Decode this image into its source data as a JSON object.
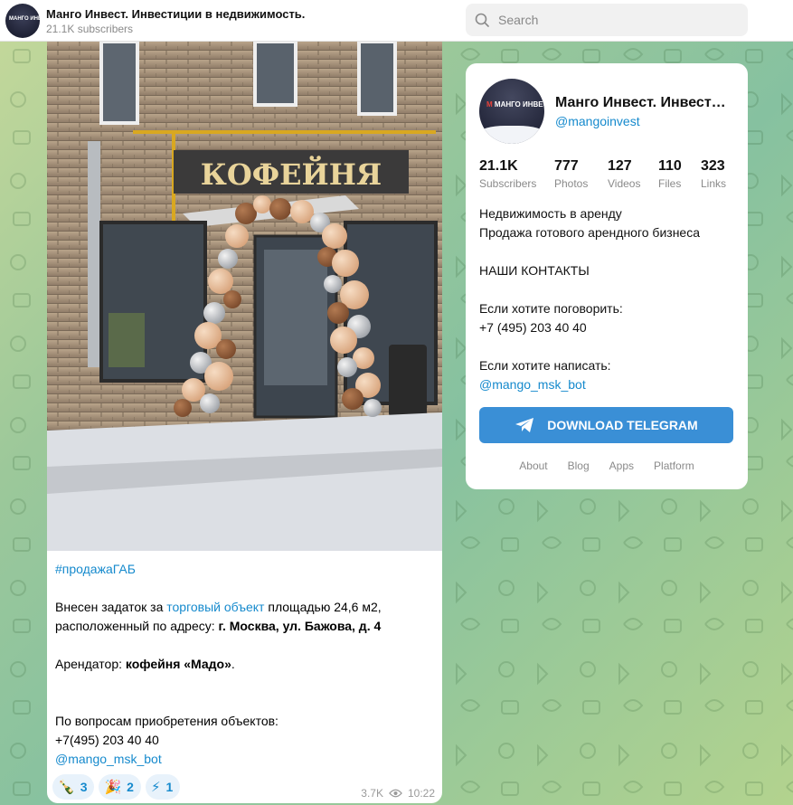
{
  "header": {
    "channel_title": "Манго Инвест. Инвестиции в недвижимость.",
    "subscribers": "21.1K subscribers",
    "search_placeholder": "Search"
  },
  "post": {
    "photo_sign": "КОФЕЙНЯ",
    "hashtag": "#продажаГАБ",
    "line1_prefix": "Внесен задаток за ",
    "line1_link": "торговый объект",
    "line1_suffix": " площадью 24,6 м2, расположенный по адресу: ",
    "line1_bold": "г. Москва, ул. Бажова, д. 4",
    "tenant_prefix": "Арендатор: ",
    "tenant_bold": "кофейня «Мадо»",
    "tenant_suffix": ".",
    "contact_line": "По вопросам приобретения объектов:",
    "phone": "+7(495) 203 40 40",
    "bot_link": "@mango_msk_bot",
    "reactions": [
      {
        "emoji": "🍾",
        "count": "3"
      },
      {
        "emoji": "🎉",
        "count": "2"
      },
      {
        "emoji": "⚡",
        "count": "1"
      }
    ],
    "views": "3.7K",
    "time": "10:22"
  },
  "card": {
    "name": "Манго Инвест. Инвестиции в недвижимость.",
    "handle": "@mangoinvest",
    "avatar_text_red": "М",
    "avatar_text": "МАНГО ИНВЕСТ",
    "stats": [
      {
        "num": "21.1K",
        "label": "Subscribers"
      },
      {
        "num": "777",
        "label": "Photos"
      },
      {
        "num": "127",
        "label": "Videos"
      },
      {
        "num": "110",
        "label": "Files"
      },
      {
        "num": "323",
        "label": "Links"
      }
    ],
    "desc_lines": [
      "Недвижимость в аренду",
      "Продажа готового арендного бизнеса",
      "",
      "НАШИ КОНТАКТЫ",
      "",
      "Если хотите поговорить:",
      "+7 (495) 203 40 40",
      "",
      "Если хотите написать:"
    ],
    "desc_link": "@mango_msk_bot",
    "download_label": "DOWNLOAD TELEGRAM",
    "footer_links": [
      "About",
      "Blog",
      "Apps",
      "Platform"
    ]
  },
  "colors": {
    "accent": "#168acd",
    "button": "#3a8fd6",
    "reaction_bg": "#e8f2fb"
  }
}
